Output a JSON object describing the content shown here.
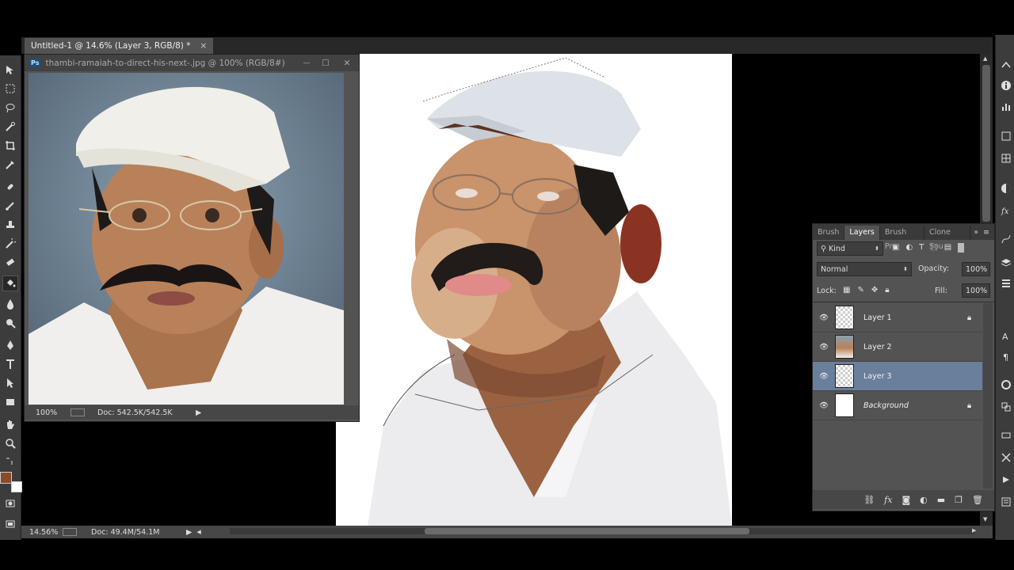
{
  "document_tab": {
    "title": "Untitled-1 @ 14.6% (Layer 3, RGB/8) *",
    "close": "×"
  },
  "reference_window": {
    "app_badge": "Ps",
    "title": "thambi-ramaiah-to-direct-his-next-.jpg @ 100% (RGB/8#)",
    "minimize": "—",
    "maximize": "☐",
    "close": "✕",
    "zoom": "100%",
    "doc_size": "Doc: 542.5K/542.5K"
  },
  "status": {
    "zoom": "14.56%",
    "doc_size": "Doc: 49.4M/54.1M"
  },
  "layers_panel": {
    "tabs": [
      "Brush",
      "Layers",
      "Brush Pre",
      "Clone Sou"
    ],
    "active_tab": "Layers",
    "menu_glyph": "▸▸",
    "filter_kind": "Kind",
    "blend_mode": "Normal",
    "opacity_label": "Opacity:",
    "opacity_value": "100%",
    "lock_label": "Lock:",
    "fill_label": "Fill:",
    "fill_value": "100%",
    "layers": [
      {
        "name": "Layer 1",
        "locked": true,
        "selected": false,
        "thumb": "checker"
      },
      {
        "name": "Layer 2",
        "locked": false,
        "selected": false,
        "thumb": "photo"
      },
      {
        "name": "Layer 3",
        "locked": false,
        "selected": true,
        "thumb": "checker"
      },
      {
        "name": "Background",
        "locked": true,
        "selected": false,
        "thumb": "white"
      }
    ]
  },
  "colors": {
    "foreground": "#8b4a2b",
    "background": "#ffffff",
    "selected_layer": "#6a7f9c",
    "panel": "#535353"
  }
}
